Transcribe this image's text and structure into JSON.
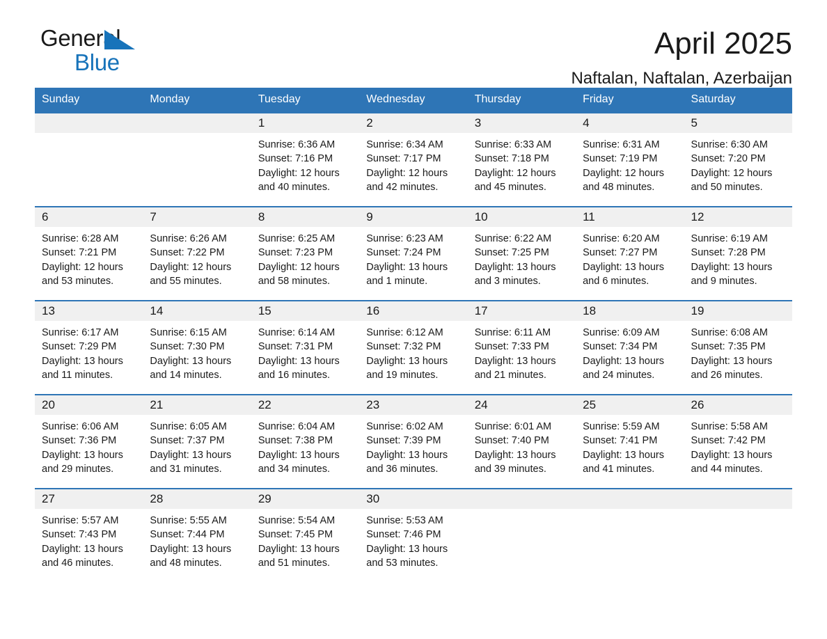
{
  "logo": {
    "primary_text": "General",
    "secondary_text": "Blue",
    "triangle_icon": "blue-triangle-icon",
    "primary_color": "#1a1a1a",
    "secondary_color": "#1773ba"
  },
  "header": {
    "month_title": "April 2025",
    "location": "Naftalan, Naftalan, Azerbaijan",
    "accent_color": "#2e75b6",
    "band_color": "#f0f0f0"
  },
  "weekday_headers": [
    "Sunday",
    "Monday",
    "Tuesday",
    "Wednesday",
    "Thursday",
    "Friday",
    "Saturday"
  ],
  "weeks": [
    [
      {
        "day": "",
        "empty": true
      },
      {
        "day": "",
        "empty": true
      },
      {
        "day": "1",
        "sunrise": "Sunrise: 6:36 AM",
        "sunset": "Sunset: 7:16 PM",
        "daylight_line1": "Daylight: 12 hours",
        "daylight_line2": "and 40 minutes."
      },
      {
        "day": "2",
        "sunrise": "Sunrise: 6:34 AM",
        "sunset": "Sunset: 7:17 PM",
        "daylight_line1": "Daylight: 12 hours",
        "daylight_line2": "and 42 minutes."
      },
      {
        "day": "3",
        "sunrise": "Sunrise: 6:33 AM",
        "sunset": "Sunset: 7:18 PM",
        "daylight_line1": "Daylight: 12 hours",
        "daylight_line2": "and 45 minutes."
      },
      {
        "day": "4",
        "sunrise": "Sunrise: 6:31 AM",
        "sunset": "Sunset: 7:19 PM",
        "daylight_line1": "Daylight: 12 hours",
        "daylight_line2": "and 48 minutes."
      },
      {
        "day": "5",
        "sunrise": "Sunrise: 6:30 AM",
        "sunset": "Sunset: 7:20 PM",
        "daylight_line1": "Daylight: 12 hours",
        "daylight_line2": "and 50 minutes."
      }
    ],
    [
      {
        "day": "6",
        "sunrise": "Sunrise: 6:28 AM",
        "sunset": "Sunset: 7:21 PM",
        "daylight_line1": "Daylight: 12 hours",
        "daylight_line2": "and 53 minutes."
      },
      {
        "day": "7",
        "sunrise": "Sunrise: 6:26 AM",
        "sunset": "Sunset: 7:22 PM",
        "daylight_line1": "Daylight: 12 hours",
        "daylight_line2": "and 55 minutes."
      },
      {
        "day": "8",
        "sunrise": "Sunrise: 6:25 AM",
        "sunset": "Sunset: 7:23 PM",
        "daylight_line1": "Daylight: 12 hours",
        "daylight_line2": "and 58 minutes."
      },
      {
        "day": "9",
        "sunrise": "Sunrise: 6:23 AM",
        "sunset": "Sunset: 7:24 PM",
        "daylight_line1": "Daylight: 13 hours",
        "daylight_line2": "and 1 minute."
      },
      {
        "day": "10",
        "sunrise": "Sunrise: 6:22 AM",
        "sunset": "Sunset: 7:25 PM",
        "daylight_line1": "Daylight: 13 hours",
        "daylight_line2": "and 3 minutes."
      },
      {
        "day": "11",
        "sunrise": "Sunrise: 6:20 AM",
        "sunset": "Sunset: 7:27 PM",
        "daylight_line1": "Daylight: 13 hours",
        "daylight_line2": "and 6 minutes."
      },
      {
        "day": "12",
        "sunrise": "Sunrise: 6:19 AM",
        "sunset": "Sunset: 7:28 PM",
        "daylight_line1": "Daylight: 13 hours",
        "daylight_line2": "and 9 minutes."
      }
    ],
    [
      {
        "day": "13",
        "sunrise": "Sunrise: 6:17 AM",
        "sunset": "Sunset: 7:29 PM",
        "daylight_line1": "Daylight: 13 hours",
        "daylight_line2": "and 11 minutes."
      },
      {
        "day": "14",
        "sunrise": "Sunrise: 6:15 AM",
        "sunset": "Sunset: 7:30 PM",
        "daylight_line1": "Daylight: 13 hours",
        "daylight_line2": "and 14 minutes."
      },
      {
        "day": "15",
        "sunrise": "Sunrise: 6:14 AM",
        "sunset": "Sunset: 7:31 PM",
        "daylight_line1": "Daylight: 13 hours",
        "daylight_line2": "and 16 minutes."
      },
      {
        "day": "16",
        "sunrise": "Sunrise: 6:12 AM",
        "sunset": "Sunset: 7:32 PM",
        "daylight_line1": "Daylight: 13 hours",
        "daylight_line2": "and 19 minutes."
      },
      {
        "day": "17",
        "sunrise": "Sunrise: 6:11 AM",
        "sunset": "Sunset: 7:33 PM",
        "daylight_line1": "Daylight: 13 hours",
        "daylight_line2": "and 21 minutes."
      },
      {
        "day": "18",
        "sunrise": "Sunrise: 6:09 AM",
        "sunset": "Sunset: 7:34 PM",
        "daylight_line1": "Daylight: 13 hours",
        "daylight_line2": "and 24 minutes."
      },
      {
        "day": "19",
        "sunrise": "Sunrise: 6:08 AM",
        "sunset": "Sunset: 7:35 PM",
        "daylight_line1": "Daylight: 13 hours",
        "daylight_line2": "and 26 minutes."
      }
    ],
    [
      {
        "day": "20",
        "sunrise": "Sunrise: 6:06 AM",
        "sunset": "Sunset: 7:36 PM",
        "daylight_line1": "Daylight: 13 hours",
        "daylight_line2": "and 29 minutes."
      },
      {
        "day": "21",
        "sunrise": "Sunrise: 6:05 AM",
        "sunset": "Sunset: 7:37 PM",
        "daylight_line1": "Daylight: 13 hours",
        "daylight_line2": "and 31 minutes."
      },
      {
        "day": "22",
        "sunrise": "Sunrise: 6:04 AM",
        "sunset": "Sunset: 7:38 PM",
        "daylight_line1": "Daylight: 13 hours",
        "daylight_line2": "and 34 minutes."
      },
      {
        "day": "23",
        "sunrise": "Sunrise: 6:02 AM",
        "sunset": "Sunset: 7:39 PM",
        "daylight_line1": "Daylight: 13 hours",
        "daylight_line2": "and 36 minutes."
      },
      {
        "day": "24",
        "sunrise": "Sunrise: 6:01 AM",
        "sunset": "Sunset: 7:40 PM",
        "daylight_line1": "Daylight: 13 hours",
        "daylight_line2": "and 39 minutes."
      },
      {
        "day": "25",
        "sunrise": "Sunrise: 5:59 AM",
        "sunset": "Sunset: 7:41 PM",
        "daylight_line1": "Daylight: 13 hours",
        "daylight_line2": "and 41 minutes."
      },
      {
        "day": "26",
        "sunrise": "Sunrise: 5:58 AM",
        "sunset": "Sunset: 7:42 PM",
        "daylight_line1": "Daylight: 13 hours",
        "daylight_line2": "and 44 minutes."
      }
    ],
    [
      {
        "day": "27",
        "sunrise": "Sunrise: 5:57 AM",
        "sunset": "Sunset: 7:43 PM",
        "daylight_line1": "Daylight: 13 hours",
        "daylight_line2": "and 46 minutes."
      },
      {
        "day": "28",
        "sunrise": "Sunrise: 5:55 AM",
        "sunset": "Sunset: 7:44 PM",
        "daylight_line1": "Daylight: 13 hours",
        "daylight_line2": "and 48 minutes."
      },
      {
        "day": "29",
        "sunrise": "Sunrise: 5:54 AM",
        "sunset": "Sunset: 7:45 PM",
        "daylight_line1": "Daylight: 13 hours",
        "daylight_line2": "and 51 minutes."
      },
      {
        "day": "30",
        "sunrise": "Sunrise: 5:53 AM",
        "sunset": "Sunset: 7:46 PM",
        "daylight_line1": "Daylight: 13 hours",
        "daylight_line2": "and 53 minutes."
      },
      {
        "day": "",
        "empty": true
      },
      {
        "day": "",
        "empty": true
      },
      {
        "day": "",
        "empty": true
      }
    ]
  ]
}
